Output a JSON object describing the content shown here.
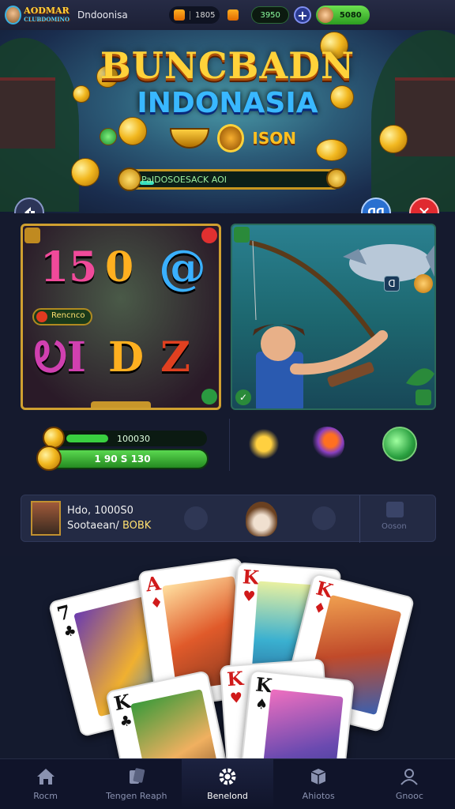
{
  "header": {
    "logo_text": "AODMAR",
    "logo_sub": "CLUBDOMINO",
    "region": "Dndoonisa",
    "pill1_value": "1805",
    "pill2_value": "3950",
    "plus_label": "+",
    "gold_pill_value": "5080"
  },
  "banner": {
    "title_line1": "BUNCBADN",
    "title_line2": "INDONASIA",
    "subtitle": "ISON",
    "progress_label": "PaIDOSOESACK AOI",
    "progress_fraction": 0.07,
    "back_icon": "back-arrow-icon",
    "blue_button_label": "ᗡᗡ",
    "close_label": "✕"
  },
  "games": {
    "slot": {
      "symbols": [
        "15",
        "0",
        "@",
        "ᎧI",
        "D",
        "Z"
      ],
      "label": "Rencnco"
    },
    "fishing": {
      "badge": "ᗡ"
    }
  },
  "rewards": {
    "bar1_value": "100030",
    "bar1_fraction": 0.3,
    "bar2_value": "1 90 S 130"
  },
  "info_bar": {
    "line1": "Hdo, 1000S0",
    "line2_prefix": "Sootaean/",
    "line2_value": "BOBK",
    "side_label": "Ooson"
  },
  "playing_cards": [
    {
      "rank": "7",
      "suit": "♣",
      "color": "#111111"
    },
    {
      "rank": "A",
      "suit": "♦",
      "color": "#d01a1a"
    },
    {
      "rank": "K",
      "suit": "♥",
      "color": "#d01a1a"
    },
    {
      "rank": "K",
      "suit": "♦",
      "color": "#d01a1a"
    },
    {
      "rank": "K",
      "suit": "♣",
      "color": "#111111"
    },
    {
      "rank": "K",
      "suit": "♥",
      "color": "#d01a1a"
    },
    {
      "rank": "K",
      "suit": "♠",
      "color": "#111111"
    }
  ],
  "tabs": [
    {
      "label": "Rocm",
      "icon": "home-icon",
      "active": false
    },
    {
      "label": "Tengen Reaph",
      "icon": "cards-icon",
      "active": false
    },
    {
      "label": "Benelond",
      "icon": "gear-icon",
      "active": true
    },
    {
      "label": "Ahiotos",
      "icon": "box-icon",
      "active": false
    },
    {
      "label": "Gnooc",
      "icon": "person-icon",
      "active": false
    }
  ],
  "colors": {
    "accent_gold": "#ffd23a",
    "accent_blue": "#39b8ff",
    "accent_green": "#39d040",
    "bg": "#151a2e"
  }
}
